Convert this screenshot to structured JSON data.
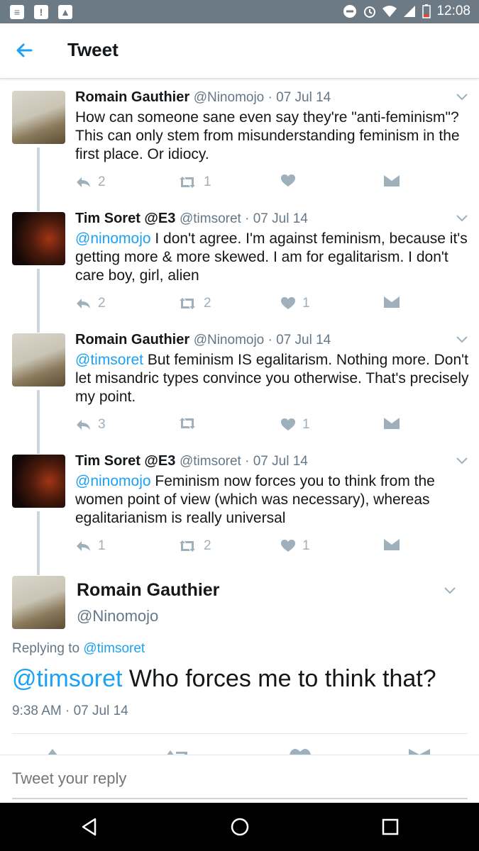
{
  "status_bar": {
    "time": "12:08",
    "left_icons": [
      "notification-icon",
      "alert-icon",
      "image-icon"
    ],
    "right_icons": [
      "do-not-disturb-icon",
      "alarm-icon",
      "wifi-icon",
      "signal-icon",
      "battery-low-icon"
    ]
  },
  "app_bar": {
    "title": "Tweet",
    "back_icon": "arrow-left-icon"
  },
  "thread": [
    {
      "name": "Romain Gauthier",
      "handle": "@Ninomojo",
      "date": "07 Jul 14",
      "mention": "",
      "text": "How can someone sane even say they're \"anti-feminism\"? This can only stem from misunderstanding feminism in the first place. Or idiocy.",
      "replies": "2",
      "retweets": "1",
      "likes": ""
    },
    {
      "name": "Tim Soret @E3",
      "handle": "@timsoret",
      "date": "07 Jul 14",
      "mention": "@ninomojo",
      "text": " I don't agree. I'm against feminism, because it's getting more & more skewed. I am for egalitarism. I don't care boy, girl, alien",
      "replies": "2",
      "retweets": "2",
      "likes": "1"
    },
    {
      "name": "Romain Gauthier",
      "handle": "@Ninomojo",
      "date": "07 Jul 14",
      "mention": "@timsoret",
      "text": " But feminism IS egalitarism. Nothing more. Don't let misandric types convince you otherwise. That's precisely my point.",
      "replies": "3",
      "retweets": "",
      "likes": "1"
    },
    {
      "name": "Tim Soret @E3",
      "handle": "@timsoret",
      "date": "07 Jul 14",
      "mention": "@ninomojo",
      "text": " Feminism now forces you to think from the women point of view (which was necessary), whereas egalitarianism is really universal",
      "replies": "1",
      "retweets": "2",
      "likes": "1"
    }
  ],
  "main_tweet": {
    "name": "Romain Gauthier",
    "handle": "@Ninomojo",
    "replying_prefix": "Replying to",
    "replying_to": "@timsoret",
    "mention": "@timsoret",
    "text": " Who forces me to think that?",
    "timestamp": "9:38 AM · 07 Jul 14"
  },
  "reply_bar": {
    "placeholder": "Tweet your reply"
  },
  "nav_bar": {
    "buttons": [
      "back-triangle-icon",
      "home-circle-icon",
      "recents-square-icon"
    ]
  },
  "colors": {
    "accent": "#1da1f2",
    "status_bar": "#6c7a86",
    "secondary_text": "#657786",
    "action_icon": "#9fb0bd"
  }
}
